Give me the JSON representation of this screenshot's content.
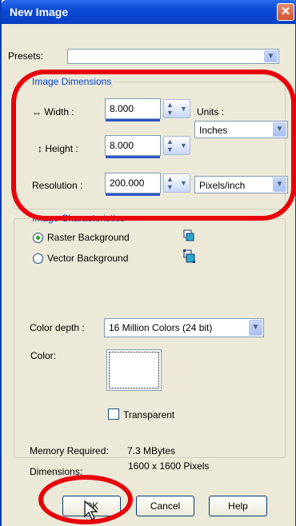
{
  "window": {
    "title": "New Image",
    "close_icon": "close-icon"
  },
  "presets": {
    "label": "Presets:",
    "value": ""
  },
  "image_dimensions": {
    "group_label": "Image Dimensions",
    "width_label": "Width :",
    "width_value": "8.000",
    "height_label": "Height :",
    "height_value": "8.000",
    "units_label": "Units :",
    "units_value": "Inches",
    "resolution_label": "Resolution :",
    "resolution_value": "200.000",
    "resolution_units_value": "Pixels/inch"
  },
  "image_characteristics": {
    "group_label": "Image Characteristics",
    "raster_label": "Raster Background",
    "raster_selected": true,
    "vector_label": "Vector Background",
    "vector_selected": false,
    "color_depth_label": "Color depth :",
    "color_depth_value": "16 Million Colors (24 bit)",
    "color_label": "Color:",
    "transparent_label": "Transparent",
    "transparent_checked": false
  },
  "info": {
    "memory_label": "Memory Required:",
    "memory_value": "7.3 MBytes",
    "dimensions_label": "Dimensions:",
    "dimensions_value": "1600 x 1600 Pixels"
  },
  "buttons": {
    "ok": "OK",
    "cancel": "Cancel",
    "help": "Help"
  },
  "colors": {
    "title_bar": "#0a4ad6",
    "dialog_bg": "#ece9d8",
    "annotation": "#e8000b",
    "group_label": "#0046d5"
  }
}
